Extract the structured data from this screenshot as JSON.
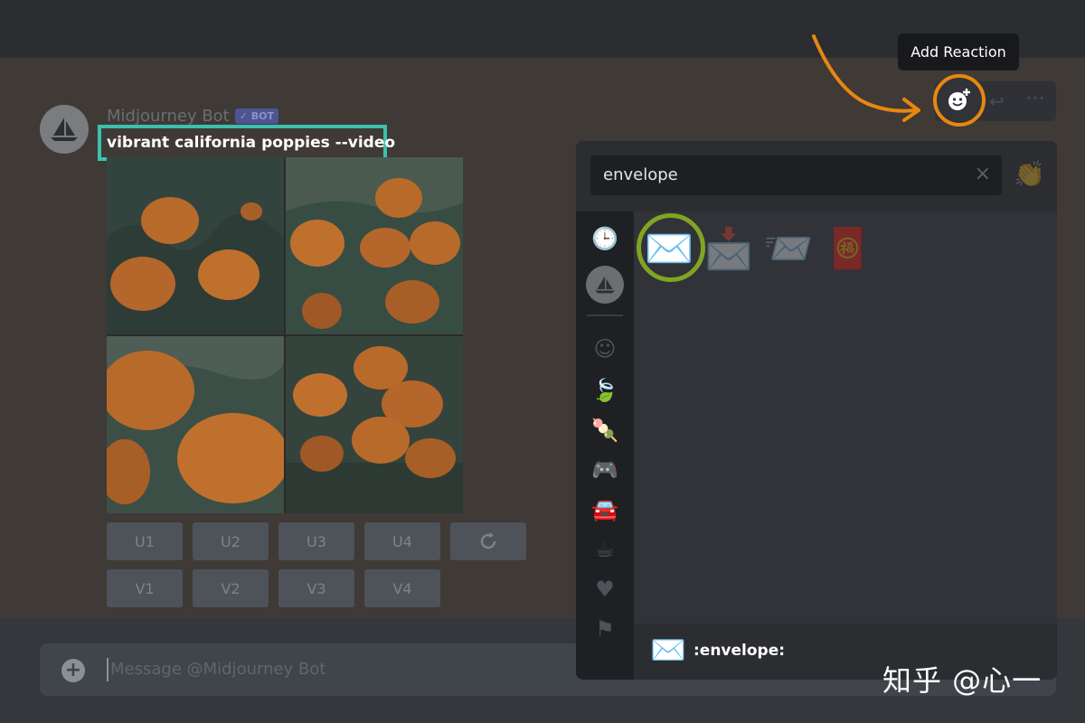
{
  "message": {
    "author": "Midjourney Bot",
    "badge": "✓ BOT",
    "prompt": "vibrant california poppies --video"
  },
  "buttons": {
    "row1": [
      "U1",
      "U2",
      "U3",
      "U4"
    ],
    "refresh_icon": "refresh-icon",
    "row2": [
      "V1",
      "V2",
      "V3",
      "V4"
    ]
  },
  "composer": {
    "placeholder": "Message @Midjourney Bot"
  },
  "toolbar": {
    "tooltip": "Add Reaction",
    "add_reaction_icon": "add-reaction-icon",
    "reply_icon": "reply-icon",
    "more_icon": "more-icon"
  },
  "picker": {
    "search_value": "envelope",
    "clear_icon": "×",
    "results": [
      "✉️",
      "📩",
      "📨",
      "🧧"
    ],
    "footer_emoji": "✉️",
    "footer_name": ":envelope:",
    "categories": [
      "recent-icon",
      "guild-midjourney",
      "smile-icon",
      "leaf-icon",
      "food-icon",
      "game-icon",
      "travel-icon",
      "coffee-icon",
      "heart-icon",
      "flag-icon"
    ]
  },
  "watermark": "知乎 @心一",
  "colors": {
    "prompt_highlight": "#3dbfb0",
    "reaction_highlight": "#e8870f",
    "emoji_highlight": "#7fa522"
  }
}
